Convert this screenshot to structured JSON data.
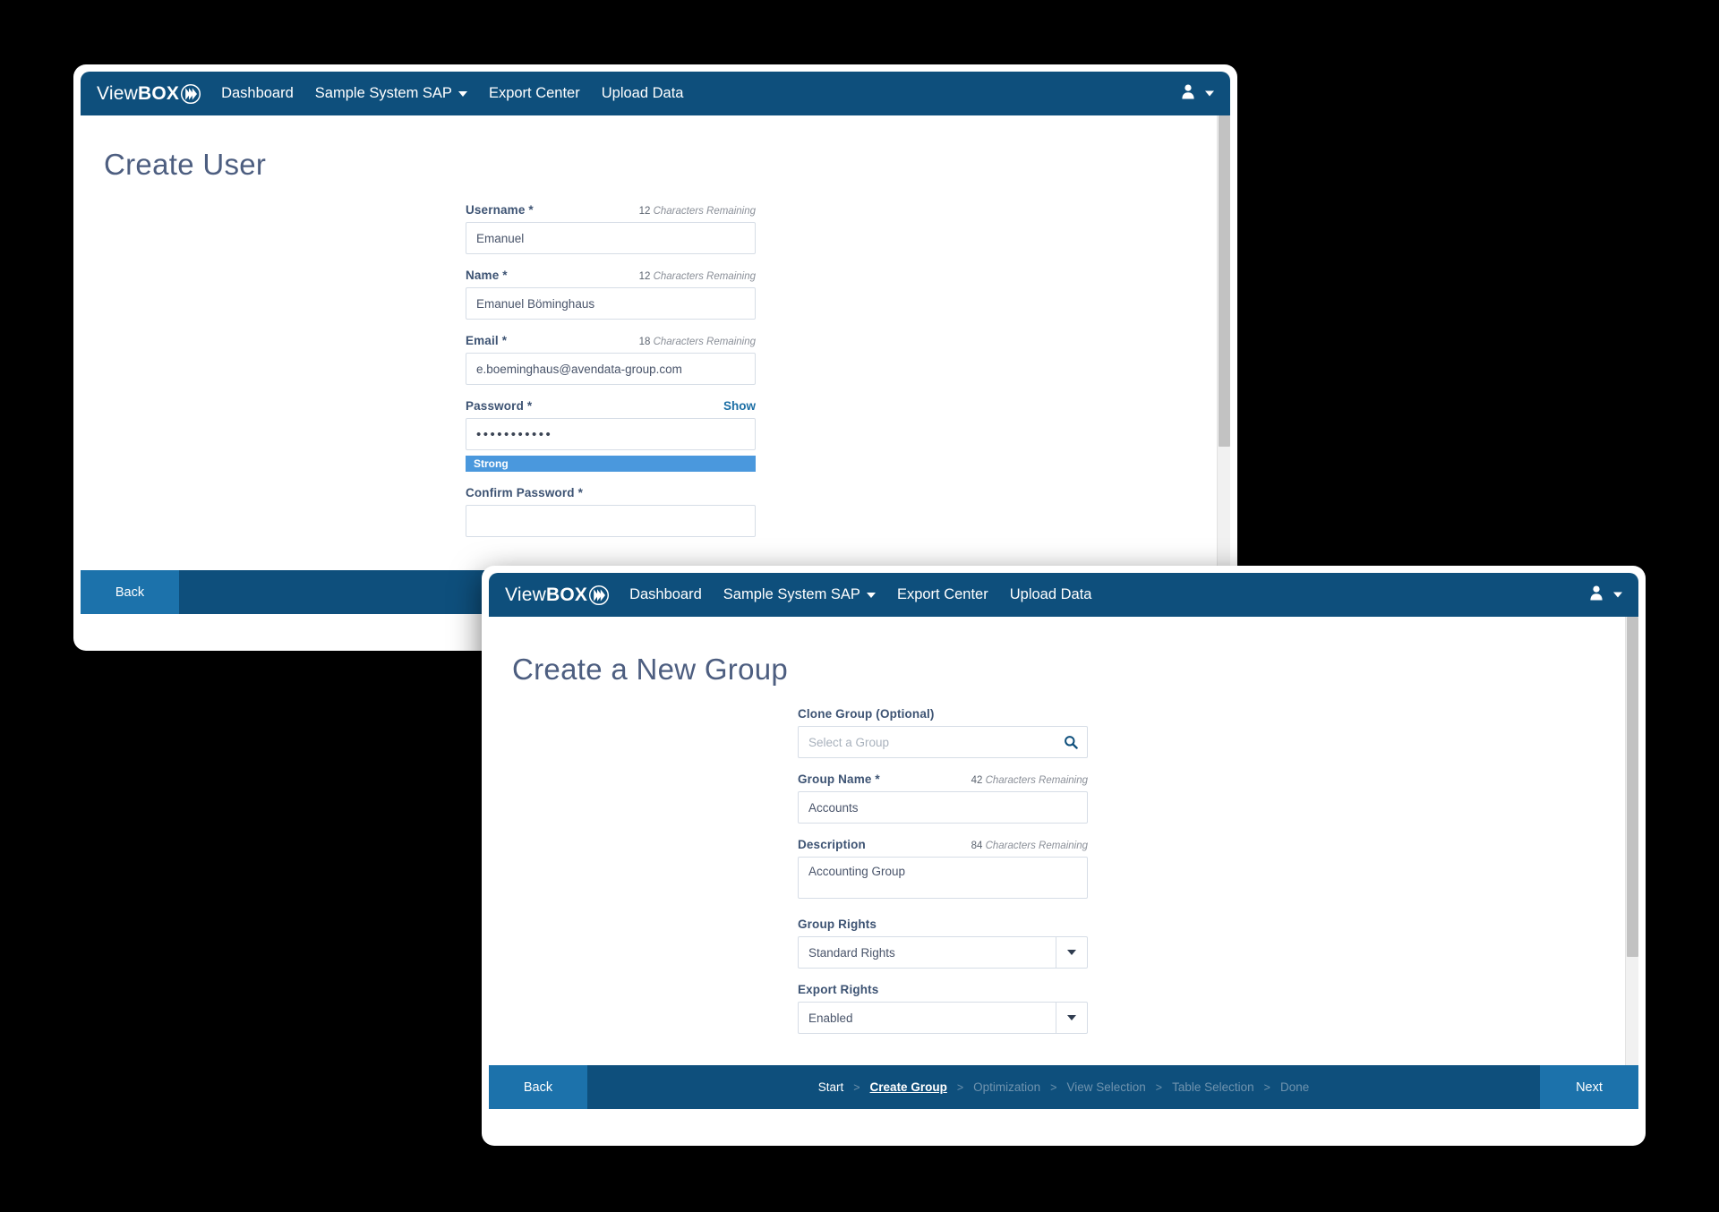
{
  "colors": {
    "navbar": "#0e4f7c",
    "accent_button": "#1c72ab",
    "strength_bar": "#4a98dd",
    "label": "#3d5373",
    "title": "#4d5e80",
    "link": "#1d6fa5"
  },
  "nav": {
    "logo_light": "View",
    "logo_bold": "BOX",
    "logo_icon": "viewbox-wave-circle-icon",
    "items": [
      {
        "label": "Dashboard",
        "has_caret": false,
        "name": "nav-dashboard"
      },
      {
        "label": "Sample System SAP",
        "has_caret": true,
        "name": "nav-sample-system-sap"
      },
      {
        "label": "Export Center",
        "has_caret": false,
        "name": "nav-export-center"
      },
      {
        "label": "Upload Data",
        "has_caret": false,
        "name": "nav-upload-data"
      }
    ],
    "user_icon": "user-avatar-icon",
    "user_caret_icon": "chevron-down-icon"
  },
  "window_user": {
    "title": "Create User",
    "fields": {
      "username": {
        "label": "Username",
        "required": "*",
        "counter_number": "12",
        "counter_text": "Characters Remaining",
        "value": "Emanuel"
      },
      "name": {
        "label": "Name",
        "required": "*",
        "counter_number": "12",
        "counter_text": "Characters Remaining",
        "value": "Emanuel Böminghaus"
      },
      "email": {
        "label": "Email",
        "required": "*",
        "counter_number": "18",
        "counter_text": "Characters Remaining",
        "value": "e.boeminghaus@avendata-group.com"
      },
      "password": {
        "label": "Password",
        "required": "*",
        "show_label": "Show",
        "value_masked": "•••••••••••",
        "strength_label": "Strong"
      },
      "confirm_password": {
        "label": "Confirm Password",
        "required": "*"
      }
    },
    "footer": {
      "back_label": "Back"
    }
  },
  "window_group": {
    "title": "Create a New Group",
    "fields": {
      "clone_group": {
        "label": "Clone Group (Optional)",
        "placeholder": "Select a Group",
        "value": "",
        "search_icon": "search-icon"
      },
      "group_name": {
        "label": "Group Name",
        "required": "*",
        "counter_number": "42",
        "counter_text": "Characters Remaining",
        "value": "Accounts"
      },
      "description": {
        "label": "Description",
        "counter_number": "84",
        "counter_text": "Characters Remaining",
        "value": "Accounting Group"
      },
      "group_rights": {
        "label": "Group Rights",
        "value": "Standard  Rights"
      },
      "export_rights": {
        "label": "Export Rights",
        "value": "Enabled"
      }
    },
    "footer": {
      "back_label": "Back",
      "next_label": "Next",
      "separator": ">",
      "steps": [
        {
          "label": "Start",
          "state": "done"
        },
        {
          "label": "Create Group",
          "state": "current"
        },
        {
          "label": "Optimization",
          "state": "upcoming"
        },
        {
          "label": "View Selection",
          "state": "upcoming"
        },
        {
          "label": "Table Selection",
          "state": "upcoming"
        },
        {
          "label": "Done",
          "state": "upcoming"
        }
      ]
    }
  }
}
